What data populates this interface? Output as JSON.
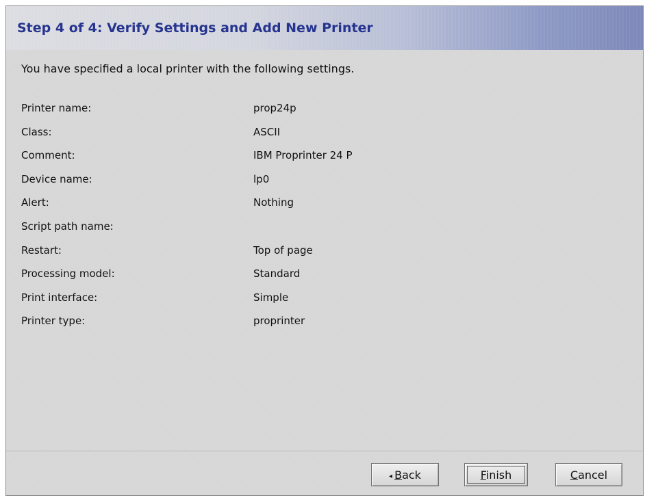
{
  "wizard": {
    "title": "Step 4 of 4: Verify Settings and Add New Printer",
    "intro": "You have specified a local printer with the following settings."
  },
  "settings": [
    {
      "label": "Printer name:",
      "value": "prop24p"
    },
    {
      "label": "Class:",
      "value": "ASCII"
    },
    {
      "label": "Comment:",
      "value": "IBM Proprinter 24 P"
    },
    {
      "label": "Device name:",
      "value": "lp0"
    },
    {
      "label": "Alert:",
      "value": "Nothing"
    },
    {
      "label": "Script path name:",
      "value": ""
    },
    {
      "label": "Restart:",
      "value": "Top of page"
    },
    {
      "label": "Processing model:",
      "value": "Standard"
    },
    {
      "label": "Print interface:",
      "value": "Simple"
    },
    {
      "label": "Printer type:",
      "value": "proprinter"
    }
  ],
  "buttons": {
    "back": {
      "arrow": "◂",
      "mnemonic": "B",
      "rest": "ack"
    },
    "finish": {
      "mnemonic": "F",
      "rest": "inish"
    },
    "cancel": {
      "mnemonic": "C",
      "rest": "ancel"
    }
  },
  "colors": {
    "title_text": "#26348f",
    "header_gradient_end": "#7d88b9",
    "panel_background": "#d7d7d7"
  }
}
